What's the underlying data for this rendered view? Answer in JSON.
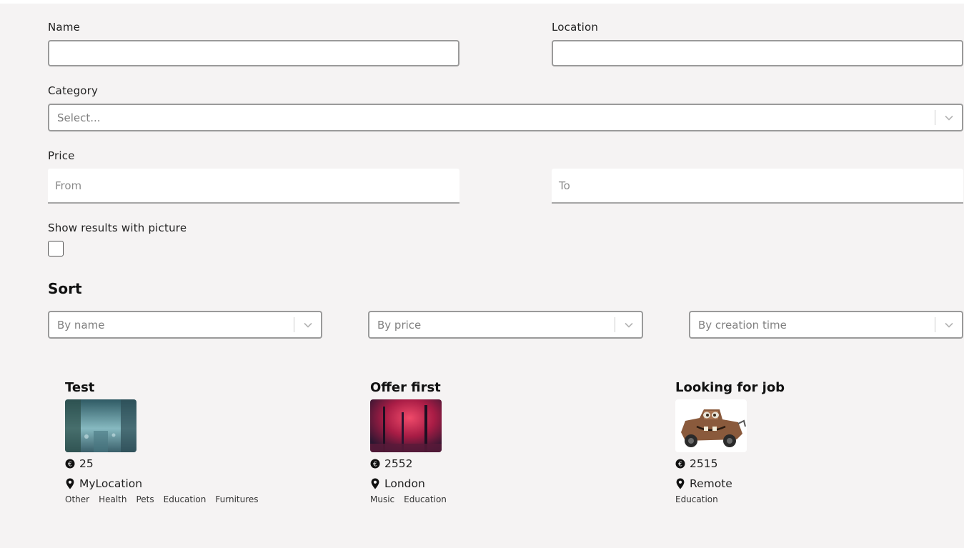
{
  "filters": {
    "name_label": "Name",
    "name_value": "",
    "location_label": "Location",
    "location_value": "",
    "category_label": "Category",
    "category_placeholder": "Select...",
    "price_label": "Price",
    "price_from_placeholder": "From",
    "price_to_placeholder": "To",
    "picture_label": "Show results with picture",
    "picture_checked": false
  },
  "sort": {
    "title": "Sort",
    "by_name": "By name",
    "by_price": "By price",
    "by_creation": "By creation time"
  },
  "results": [
    {
      "title": "Test",
      "price": "25",
      "location": "MyLocation",
      "tags": [
        "Other",
        "Health",
        "Pets",
        "Education",
        "Furnitures"
      ],
      "thumb_colors": [
        "#3d6b78",
        "#7fb0b8"
      ]
    },
    {
      "title": "Offer first",
      "price": "2552",
      "location": "London",
      "tags": [
        "Music",
        "Education"
      ],
      "thumb_colors": [
        "#3a1f3a",
        "#c8284e"
      ]
    },
    {
      "title": "Looking for job",
      "price": "2515",
      "location": "Remote",
      "tags": [
        "Education"
      ],
      "thumb_colors": [
        "#ffffff",
        "#8a5a3c"
      ]
    }
  ],
  "icons": {
    "currency": "euro-coin-icon",
    "location": "map-pin-icon",
    "dropdown": "chevron-down-icon"
  }
}
